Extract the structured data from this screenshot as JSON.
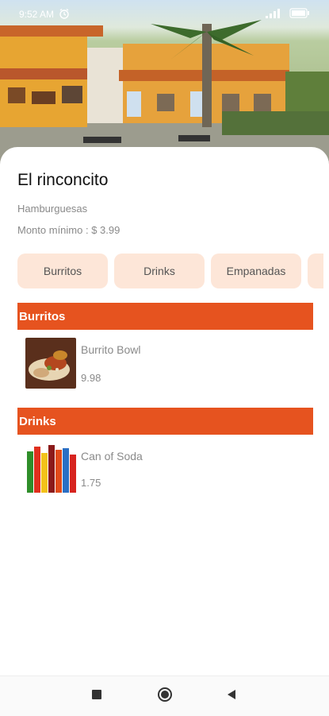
{
  "status_bar": {
    "time": "9:52 AM",
    "alarm_icon": "alarm-icon",
    "signal_icon": "signal-icon",
    "battery_icon": "battery-icon"
  },
  "restaurant": {
    "name": "El rinconcito",
    "category": "Hamburguesas",
    "minimum_order": "Monto mínimo : $ 3.99"
  },
  "category_tabs": [
    "Burritos",
    "Drinks",
    "Empanadas"
  ],
  "sections": [
    {
      "title": "Burritos",
      "items": [
        {
          "name": "Burrito Bowl",
          "price": "9.98"
        }
      ]
    },
    {
      "title": "Drinks",
      "items": [
        {
          "name": "Can of Soda",
          "price": "1.75"
        }
      ]
    }
  ],
  "navigation": {
    "recents_icon": "square-icon",
    "home_icon": "circle-icon",
    "back_icon": "back-triangle-icon"
  },
  "colors": {
    "accent": "#e6531f",
    "chip_bg": "#fde6d8"
  }
}
